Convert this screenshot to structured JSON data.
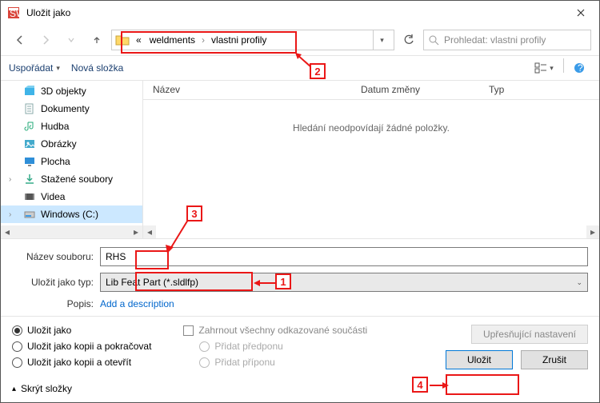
{
  "title": "Uložit jako",
  "breadcrumb": {
    "prefix": "«",
    "seg1": "weldments",
    "seg2": "vlastni profily"
  },
  "search": {
    "placeholder": "Prohledat: vlastni profily"
  },
  "toolbar": {
    "organize": "Uspořádat",
    "newfolder": "Nová složka"
  },
  "tree": {
    "items": [
      "3D objekty",
      "Dokumenty",
      "Hudba",
      "Obrázky",
      "Plocha",
      "Stažené soubory",
      "Videa",
      "Windows (C:)"
    ]
  },
  "columns": {
    "name": "Název",
    "date": "Datum změny",
    "type": "Typ"
  },
  "empty_message": "Hledání neodpovídají žádné položky.",
  "fields": {
    "name_label": "Název souboru:",
    "name_value": "RHS",
    "type_label": "Uložit jako typ:",
    "type_value": "Lib Feat Part (*.sldlfp)",
    "desc_label": "Popis:",
    "desc_link": "Add a description"
  },
  "options": {
    "r1": "Uložit jako",
    "r2": "Uložit jako kopii a pokračovat",
    "r3": "Uložit jako kopii a otevřít",
    "c1": "Zahrnout všechny odkazované součásti",
    "c2": "Přidat předponu",
    "c3": "Přidat příponu"
  },
  "buttons": {
    "advanced": "Upřesňující nastavení",
    "save": "Uložit",
    "cancel": "Zrušit"
  },
  "footer": {
    "hide": "Skrýt složky"
  },
  "anno": {
    "n1": "1",
    "n2": "2",
    "n3": "3",
    "n4": "4"
  }
}
